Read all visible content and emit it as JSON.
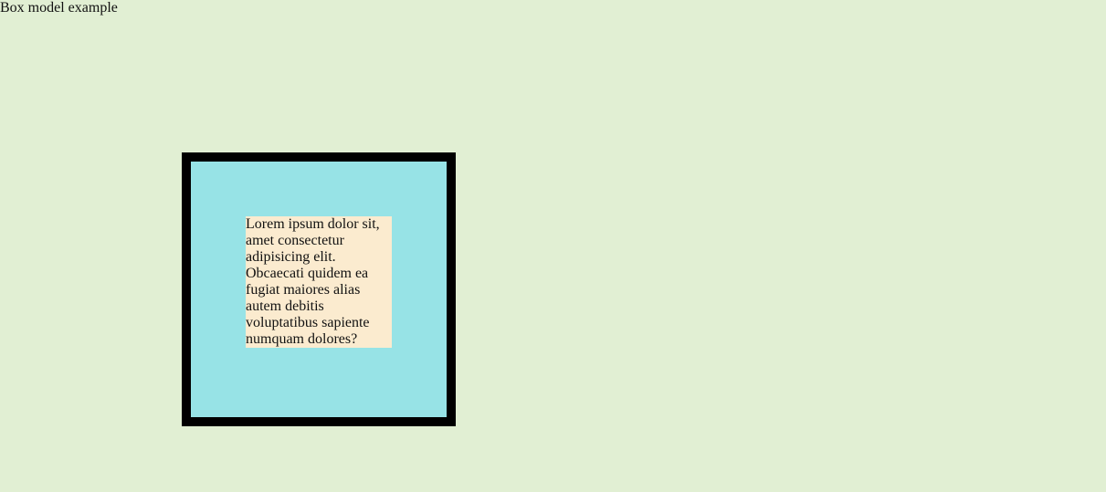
{
  "page": {
    "title": "Box model example"
  },
  "box": {
    "text": "Lorem ipsum dolor sit, amet consectetur adipisicing elit. Obcaecati quidem ea fugiat maiores alias autem debitis voluptatibus sapiente numquam dolores?"
  },
  "colors": {
    "background": "#e1efd3",
    "box_fill": "#97e3e6",
    "box_border": "#000000",
    "content_fill": "#fbebcf"
  }
}
